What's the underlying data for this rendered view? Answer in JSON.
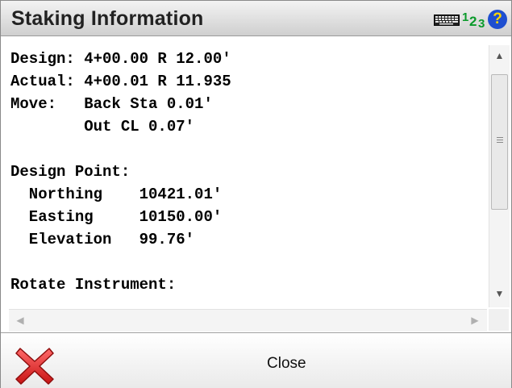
{
  "window": {
    "title": "Staking Information"
  },
  "header_icons": {
    "keyboard": "keyboard-icon",
    "numeric": "123",
    "help": "?"
  },
  "content": {
    "lines": [
      "Design: 4+00.00 R 12.00'",
      "Actual: 4+00.01 R 11.935",
      "Move:   Back Sta 0.01'",
      "        Out CL 0.07'",
      "",
      "Design Point:",
      "  Northing    10421.01'",
      "  Easting     10150.00'",
      "  Elevation   99.76'",
      "",
      "Rotate Instrument:"
    ]
  },
  "scrollbars": {
    "up_arrow": "▲",
    "down_arrow": "▼",
    "left_arrow": "◀",
    "right_arrow": "▶"
  },
  "footer": {
    "close_label": "Close"
  },
  "colors": {
    "accent_green": "#0a9a2a",
    "help_blue": "#1f4fd0",
    "close_red": "#e02020"
  }
}
